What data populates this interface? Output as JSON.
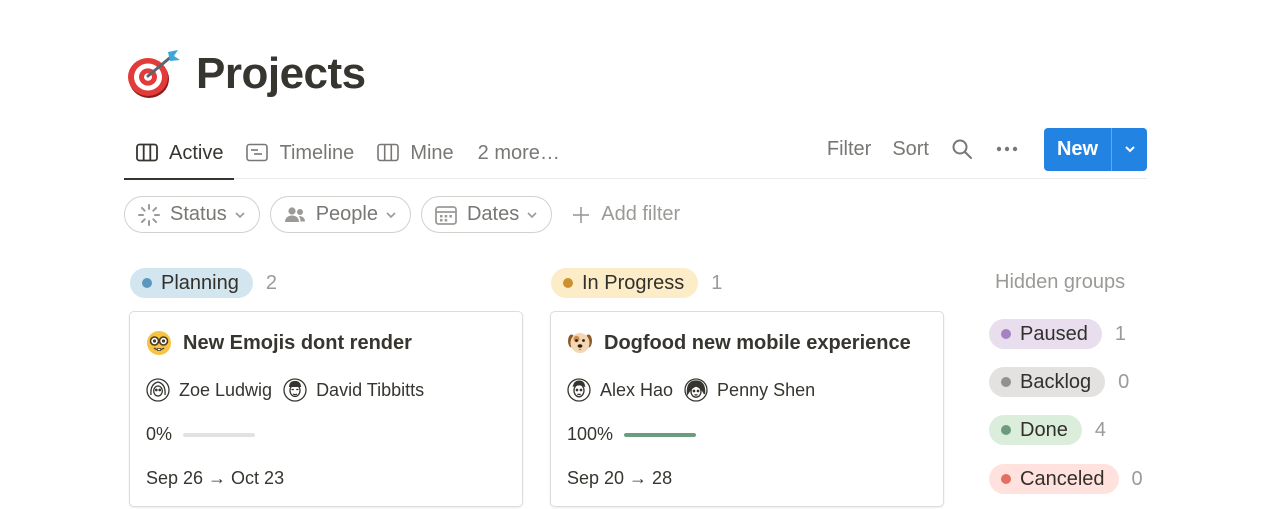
{
  "page": {
    "title": "Projects",
    "icon": "dart-target-icon"
  },
  "views": {
    "tabs": [
      {
        "label": "Active",
        "icon": "board-icon",
        "active": true
      },
      {
        "label": "Timeline",
        "icon": "timeline-icon",
        "active": false
      },
      {
        "label": "Mine",
        "icon": "board-icon",
        "active": false
      }
    ],
    "more_label": "2 more…"
  },
  "actions": {
    "filter": "Filter",
    "sort": "Sort",
    "new": "New"
  },
  "filters": [
    {
      "label": "Status",
      "icon": "status-spinner-icon"
    },
    {
      "label": "People",
      "icon": "people-icon"
    },
    {
      "label": "Dates",
      "icon": "calendar-icon"
    }
  ],
  "add_filter": "Add filter",
  "colors": {
    "accent": "#2383e2",
    "progress": "#6c9b7d",
    "text": "#37352f",
    "muted": "#787774"
  },
  "groups": [
    {
      "name": "Planning",
      "count": "2",
      "bg": "#d3e5ef",
      "dot": "#5b97bd",
      "card": {
        "emoji": "nerd-face-icon",
        "title": "New Emojis dont  render",
        "people": [
          "Zoe Ludwig",
          "David Tibbitts"
        ],
        "progress_label": "0%",
        "progress": 0,
        "dates": "Sep 26 → Oct 23"
      }
    },
    {
      "name": "In Progress",
      "count": "1",
      "bg": "#fdecc8",
      "dot": "#cb912f",
      "card": {
        "emoji": "dog-face-icon",
        "title": "Dogfood new mobile experience",
        "people": [
          "Alex Hao",
          "Penny Shen"
        ],
        "progress_label": "100%",
        "progress": 1,
        "dates": "Sep 20 → 28"
      }
    }
  ],
  "hidden": {
    "title": "Hidden groups",
    "groups": [
      {
        "name": "Paused",
        "count": "1",
        "bg": "#e8deee",
        "dot": "#a782c3"
      },
      {
        "name": "Backlog",
        "count": "0",
        "bg": "#e3e2e0",
        "dot": "#91918e"
      },
      {
        "name": "Done",
        "count": "4",
        "bg": "#dbeddb",
        "dot": "#6c9b7d"
      },
      {
        "name": "Canceled",
        "count": "0",
        "bg": "#ffe2dd",
        "dot": "#e16f64"
      }
    ]
  }
}
